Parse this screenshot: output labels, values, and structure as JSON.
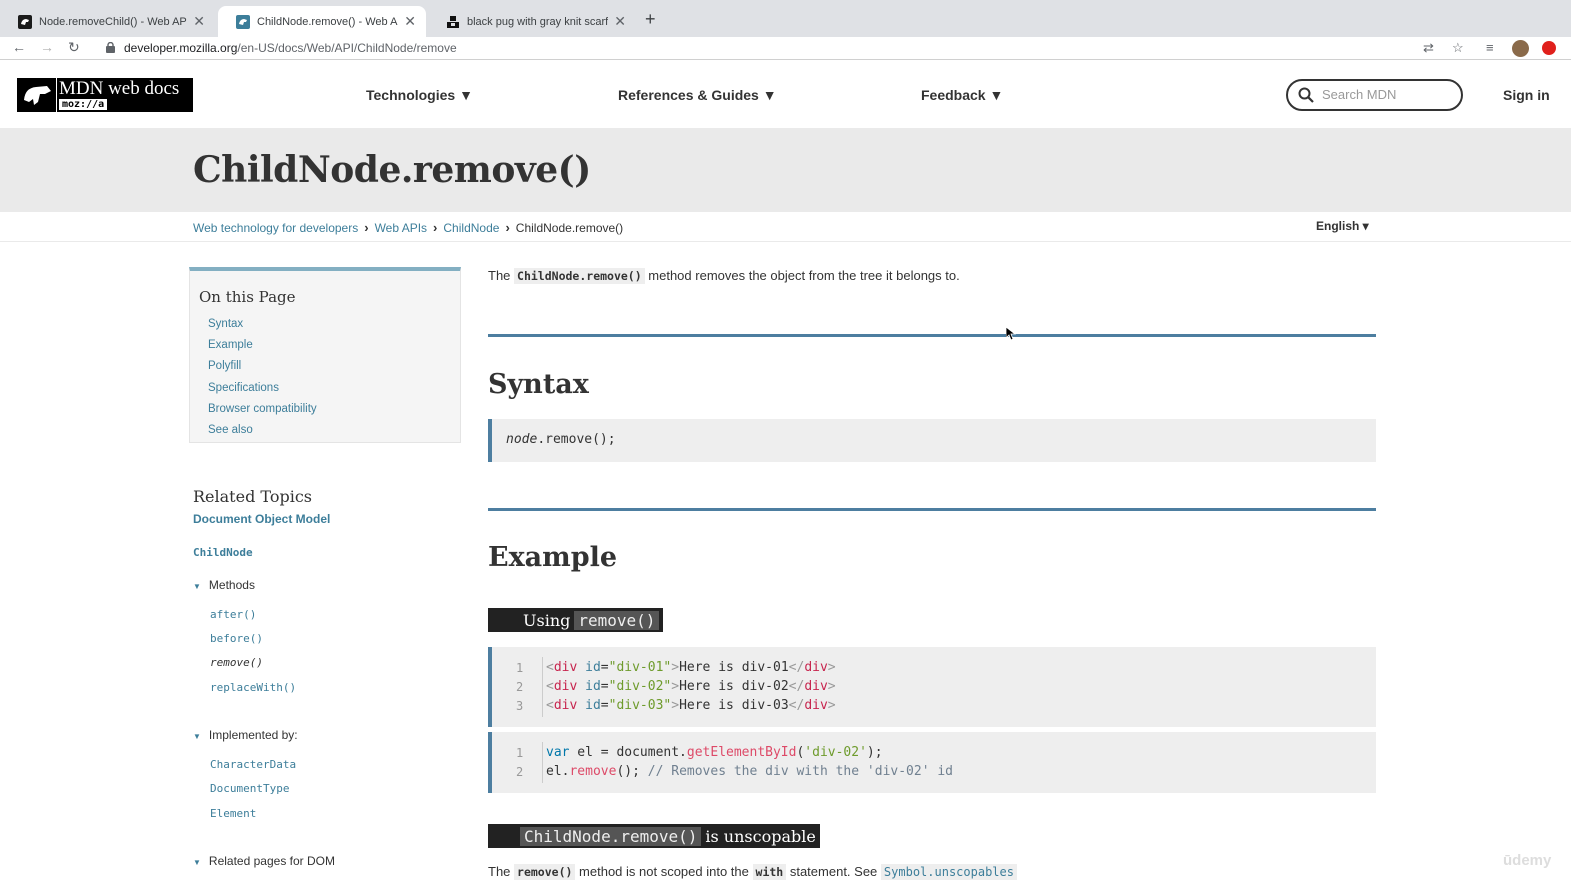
{
  "browser": {
    "tabs": [
      {
        "title": "Node.removeChild() - Web API",
        "close": "✕"
      },
      {
        "title": "ChildNode.remove() - Web API",
        "close": "✕"
      },
      {
        "title": "black pug with gray knit scarf",
        "close": "✕"
      }
    ],
    "new_tab": "+",
    "url_host": "developer.mozilla.org",
    "url_path": "/en-US/docs/Web/API/ChildNode/remove"
  },
  "header": {
    "logo_title": "MDN web docs",
    "logo_sub": "moz://a",
    "nav": [
      "Technologies ▼",
      "References & Guides ▼",
      "Feedback ▼"
    ],
    "search_placeholder": "Search MDN",
    "signin": "Sign in"
  },
  "page": {
    "title": "ChildNode.remove()",
    "breadcrumb": [
      "Web technology for developers",
      "Web APIs",
      "ChildNode",
      "ChildNode.remove()"
    ],
    "language": "English ▾"
  },
  "toc": {
    "heading": "On this Page",
    "items": [
      "Syntax",
      "Example",
      "Polyfill",
      "Specifications",
      "Browser compatibility",
      "See also"
    ]
  },
  "related": {
    "heading": "Related Topics",
    "dom": "Document Object Model",
    "childnode": "ChildNode",
    "methods_label": "Methods",
    "methods": [
      "after()",
      "before()",
      "remove()",
      "replaceWith()"
    ],
    "implemented_label": "Implemented by:",
    "implemented": [
      "CharacterData",
      "DocumentType",
      "Element"
    ],
    "related_pages_label": "Related pages for DOM"
  },
  "content": {
    "intro_before": "The",
    "intro_code": "ChildNode.remove()",
    "intro_after": "method removes the object from the tree it belongs to.",
    "syntax_heading": "Syntax",
    "syntax_obj": "node",
    "syntax_rest": ".remove();",
    "example_heading": "Example",
    "using_label": "Using",
    "using_code": "remove()",
    "html_lines": [
      {
        "n": "1",
        "id": "\"div-01\"",
        "text": "Here is div-01"
      },
      {
        "n": "2",
        "id": "\"div-02\"",
        "text": "Here is div-02"
      },
      {
        "n": "3",
        "id": "\"div-03\"",
        "text": "Here is div-03"
      }
    ],
    "js_line1": {
      "n": "1",
      "kw": "var",
      "a": " el = document.",
      "fn": "getElementById",
      "p1": "(",
      "str": "'div-02'",
      "p2": ");"
    },
    "js_line2": {
      "n": "2",
      "a": "el.",
      "fn": "remove",
      "p": "(); ",
      "cmt": "// Removes the div with the 'div-02' id"
    },
    "unscopable_code": "ChildNode.remove()",
    "unscopable_text": "is unscopable",
    "bottom_before": "The",
    "bottom_code1": "remove()",
    "bottom_mid": "method is not scoped into the",
    "bottom_code2": "with",
    "bottom_after": "statement. See",
    "bottom_link": "Symbol.unscopables"
  },
  "watermark": "ūdemy"
}
